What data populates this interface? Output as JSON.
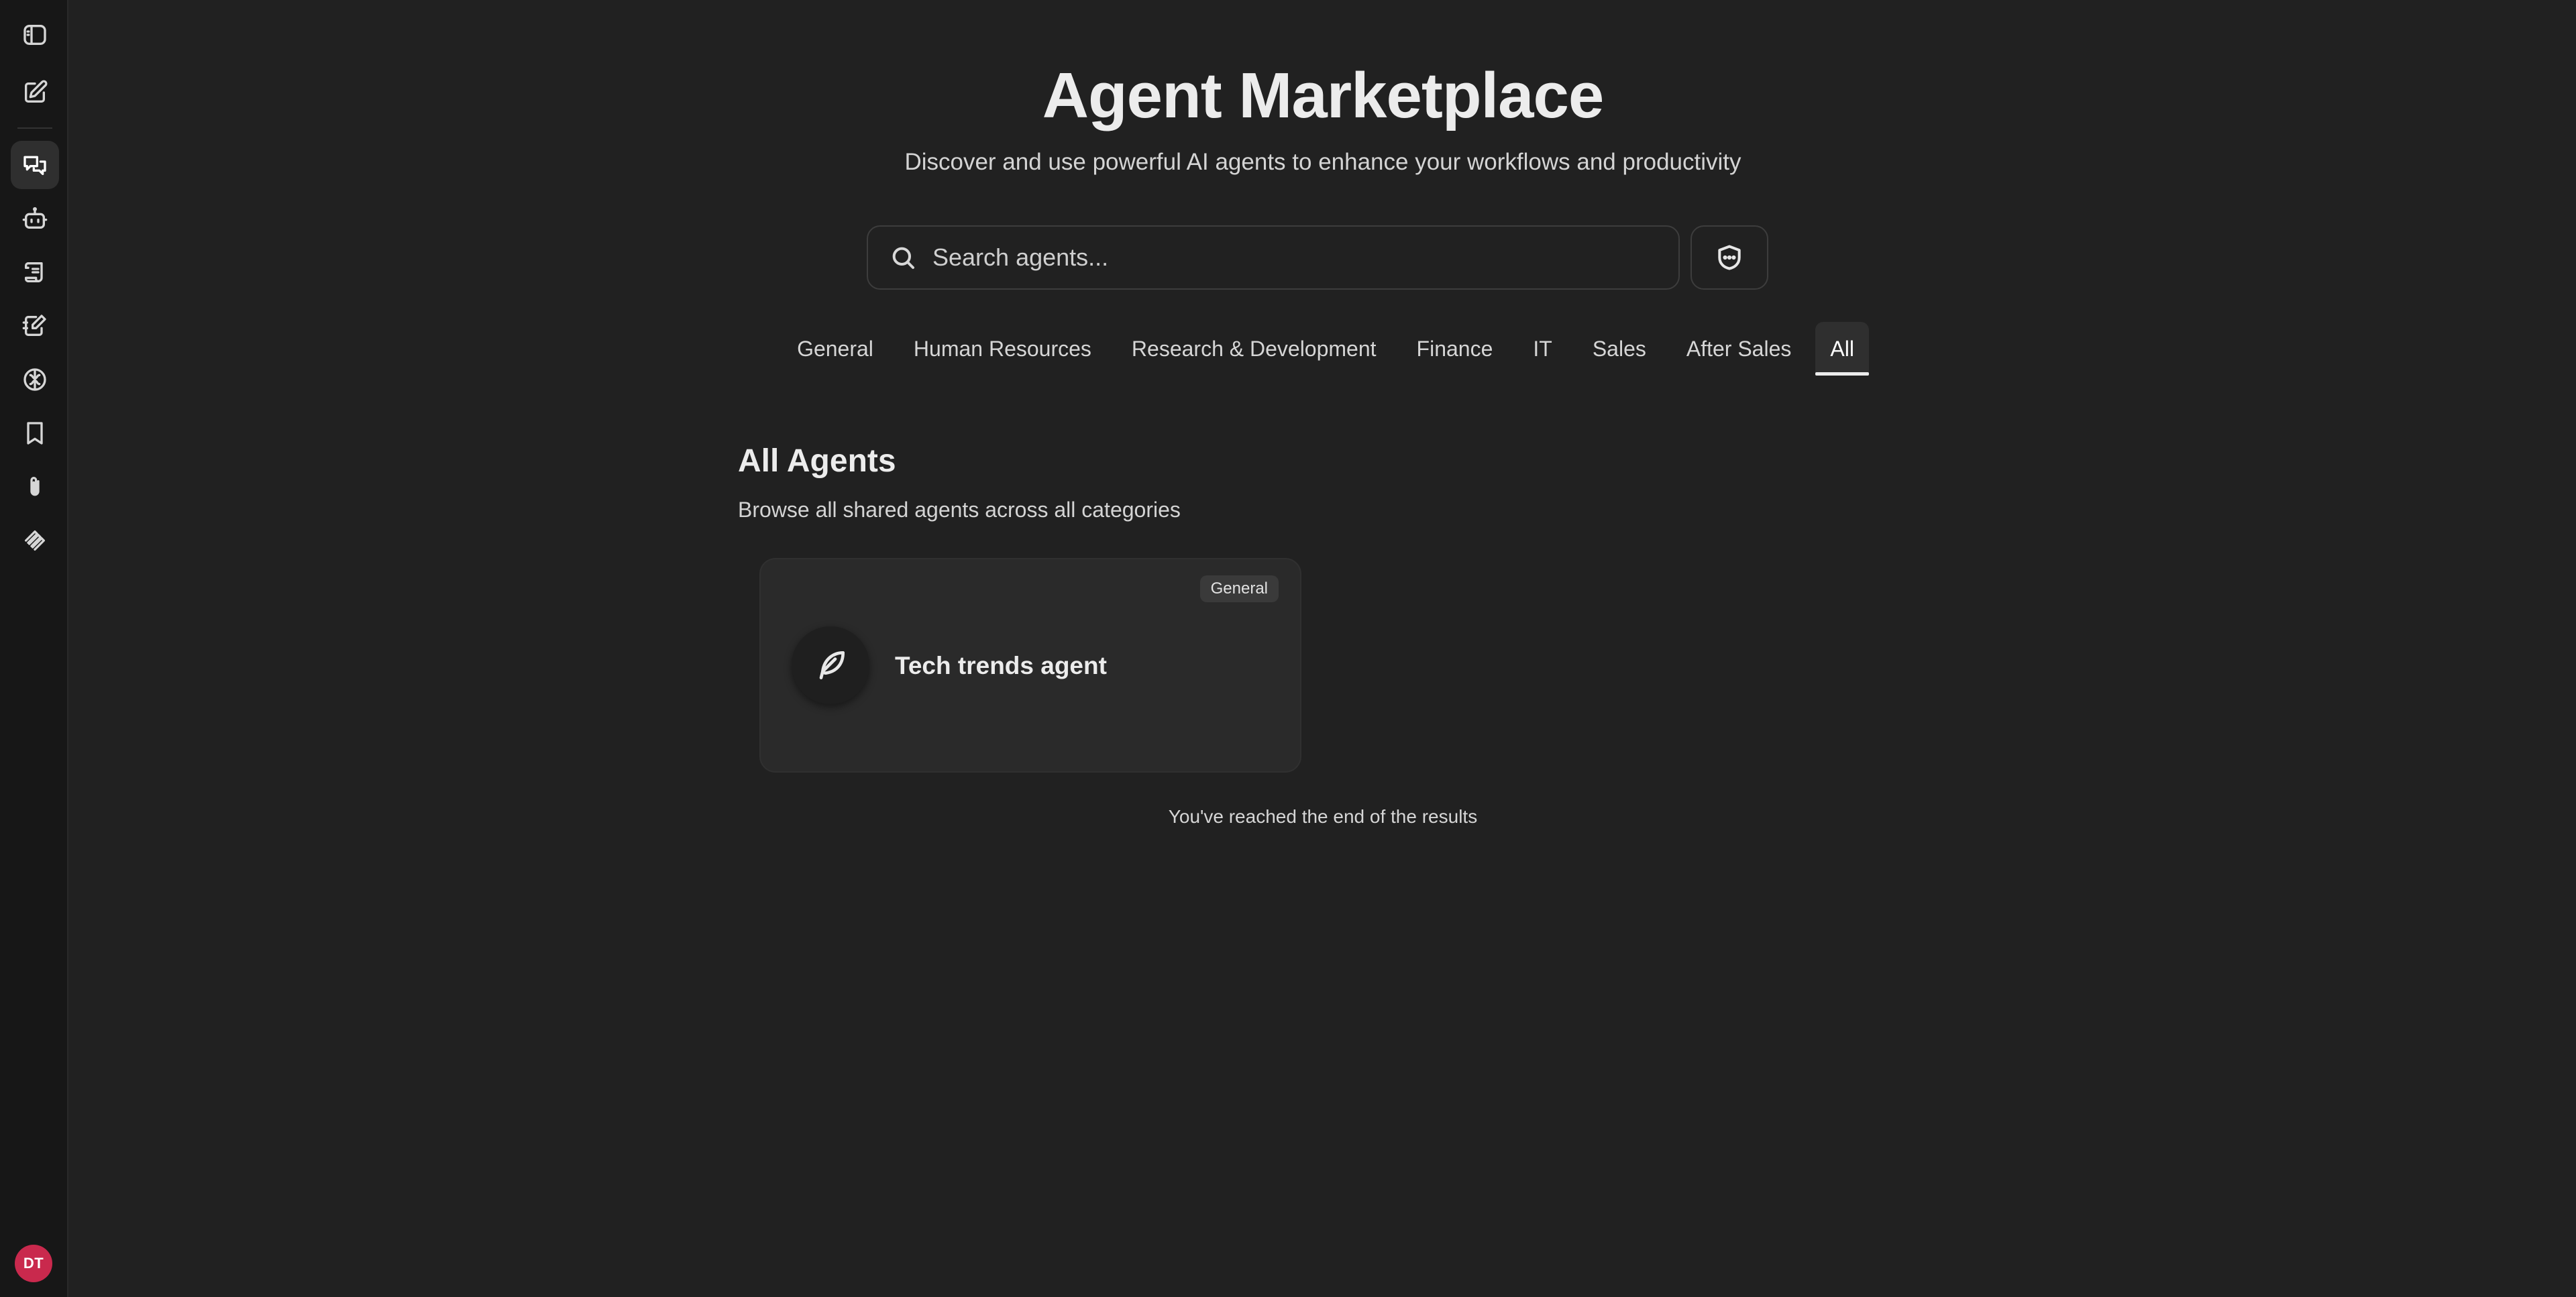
{
  "header": {
    "title": "Agent Marketplace",
    "subtitle": "Discover and use powerful AI agents to enhance your workflows and productivity"
  },
  "search": {
    "placeholder": "Search agents...",
    "value": ""
  },
  "tabs": [
    {
      "label": "General",
      "active": false
    },
    {
      "label": "Human Resources",
      "active": false
    },
    {
      "label": "Research & Development",
      "active": false
    },
    {
      "label": "Finance",
      "active": false
    },
    {
      "label": "IT",
      "active": false
    },
    {
      "label": "Sales",
      "active": false
    },
    {
      "label": "After Sales",
      "active": false
    },
    {
      "label": "All",
      "active": true
    }
  ],
  "section": {
    "title": "All Agents",
    "subtitle": "Browse all shared agents across all categories"
  },
  "agents": [
    {
      "name": "Tech trends agent",
      "category": "General",
      "icon": "feather-icon"
    }
  ],
  "footer": {
    "end_text": "You've reached the end of the results"
  },
  "sidebar": {
    "icons": [
      "panel-toggle-icon",
      "new-chat-icon",
      "chats-icon",
      "agents-icon",
      "prompts-icon",
      "memories-icon",
      "brain-icon",
      "bookmarks-icon",
      "attachments-icon",
      "mcp-icon"
    ],
    "active": "chats-icon",
    "user_initials": "DT"
  },
  "colors": {
    "background": "#212121",
    "rail": "#171717",
    "card": "#2a2a2a",
    "avatar": "#c9294d"
  }
}
